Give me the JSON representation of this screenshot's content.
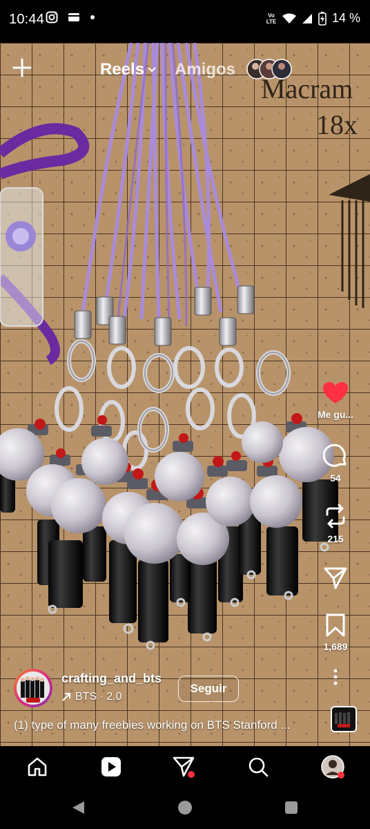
{
  "status_bar": {
    "time": "10:44",
    "network": "Vo LTE",
    "battery": "14 %"
  },
  "header": {
    "tab_reels": "Reels",
    "tab_friends": "Amigos"
  },
  "actions": {
    "like_label": "Me gu...",
    "comments_count": "54",
    "reposts_count": "215",
    "saves_count": "1,689"
  },
  "post": {
    "username": "crafting_and_bts",
    "audio": "BTS · 2.0",
    "follow_label": "Seguir",
    "caption": "(1) type of many freebies working on BTS Stanford ..."
  },
  "board_text": {
    "line1": "Macram",
    "line2": "18x"
  },
  "colors": {
    "like": "#ff3040",
    "notification_dot": "#ff3040",
    "cord_purple": "#a98be0",
    "board": "#b9956c"
  },
  "icons": {
    "add": "plus-icon",
    "home": "home-icon",
    "reels": "reels-icon",
    "share": "send-icon",
    "search": "search-icon",
    "profile": "profile-avatar"
  }
}
